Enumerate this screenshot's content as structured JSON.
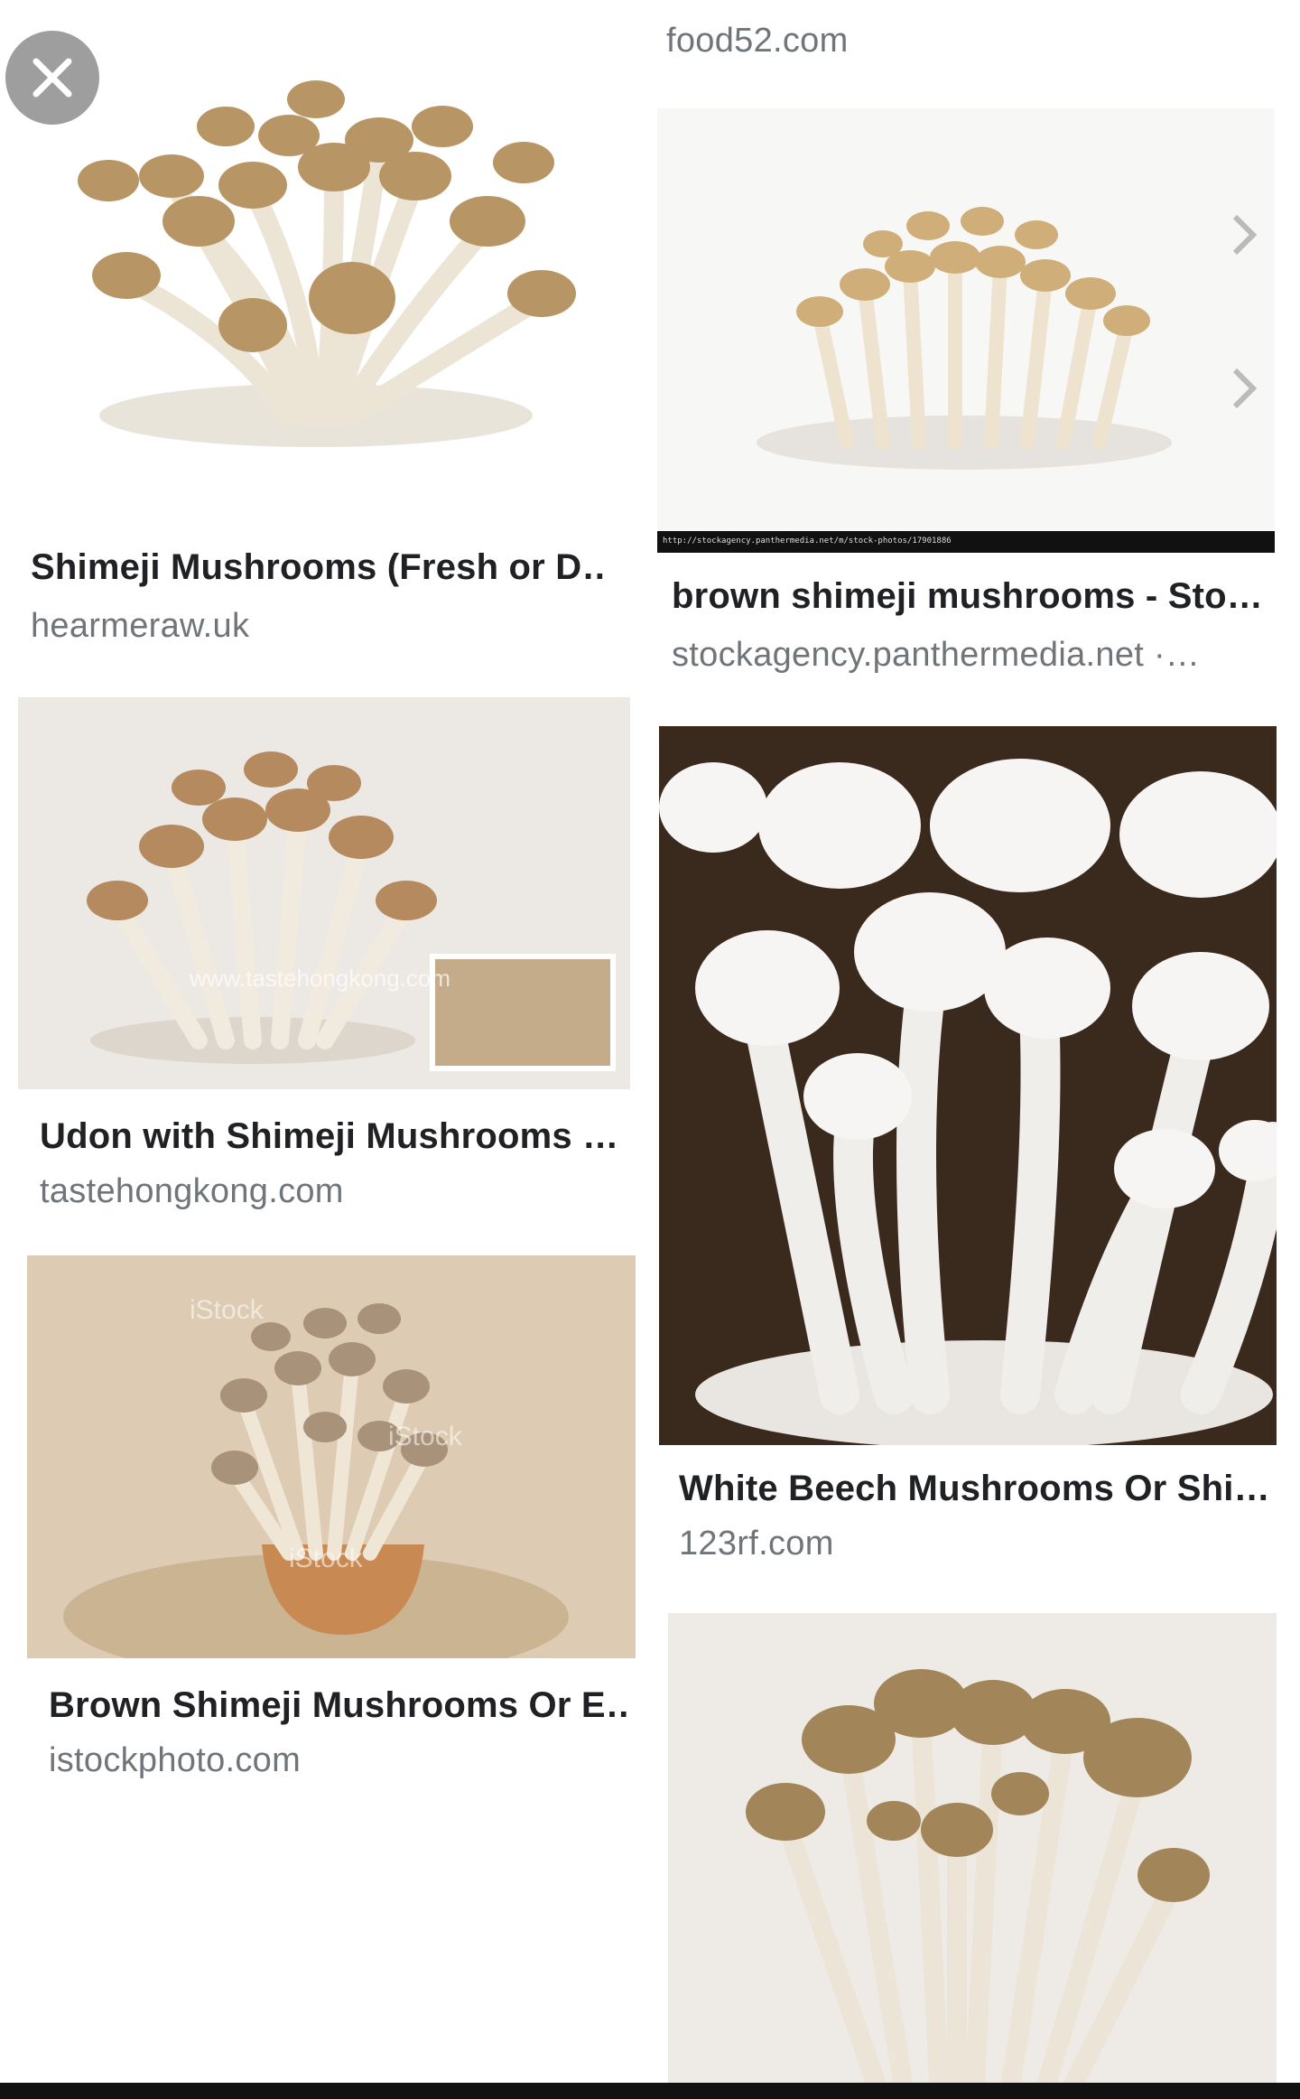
{
  "close_button": {
    "icon": "close-icon",
    "label": "Close"
  },
  "results": [
    {
      "id": "hearmeraw",
      "title": "Shimeji Mushrooms (Fresh or D…",
      "source": "hearmeraw.uk",
      "image": "brown-shimeji-cluster"
    },
    {
      "id": "food52",
      "title": "",
      "source": "food52.com",
      "image": ""
    },
    {
      "id": "panthermedia",
      "title": "brown shimeji mushrooms - Sto…",
      "source": "stockagency.panthermedia.net ·…",
      "image": "brown-shimeji-stock",
      "image_caption": "http://stockagency.panthermedia.net/m/stock-photos/17901886"
    },
    {
      "id": "tastehongkong",
      "title": "Udon with Shimeji Mushrooms …",
      "source": "tastehongkong.com",
      "image": "brown-shimeji-watermarked",
      "watermark": "www.tastehongkong.com"
    },
    {
      "id": "123rf",
      "title": "White Beech Mushrooms Or Shi…",
      "source": "123rf.com",
      "image": "white-beech-mushrooms"
    },
    {
      "id": "istock",
      "title": "Brown Shimeji Mushrooms Or E…",
      "source": "istockphoto.com",
      "image": "shimeji-in-wooden-bowl",
      "watermark": "iStock"
    },
    {
      "id": "bottom-right",
      "title": "",
      "source": "",
      "image": "tall-brown-shimeji"
    }
  ],
  "colors": {
    "title": "#202124",
    "source": "#70757a",
    "close_button_bg": "#9e9e9e"
  }
}
